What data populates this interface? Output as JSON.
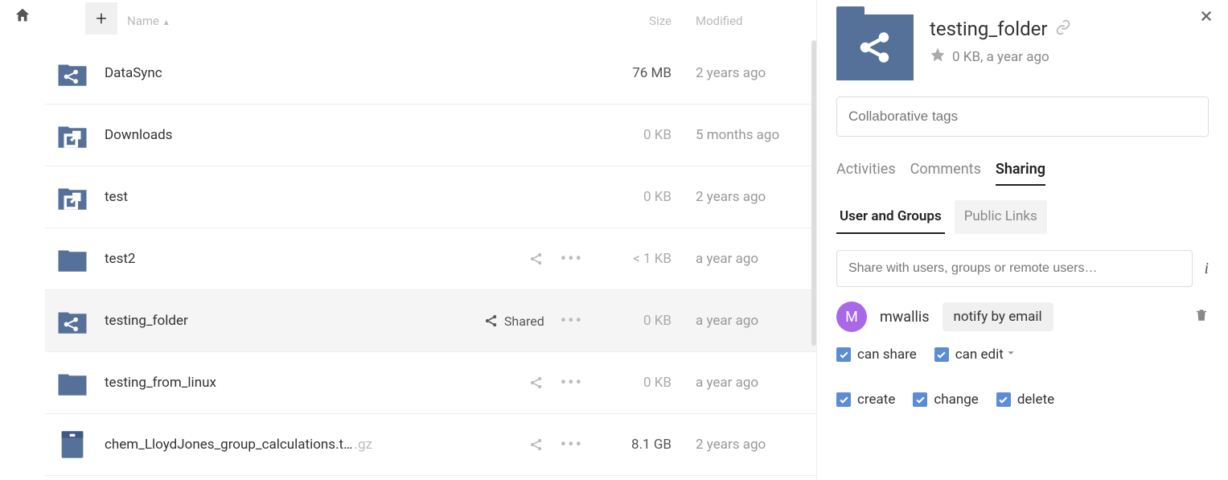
{
  "header": {
    "name": "Name",
    "sort_indicator": "▲",
    "size": "Size",
    "modified": "Modified"
  },
  "plus_label": "+",
  "files": [
    {
      "name": "DataSync",
      "icon": "folder-share",
      "size": "76 MB",
      "size_faded": false,
      "modified": "2 years ago",
      "selected": false,
      "show_actions": false,
      "shared_label": ""
    },
    {
      "name": "Downloads",
      "icon": "folder-external",
      "size": "0 KB",
      "size_faded": true,
      "modified": "5 months ago",
      "selected": false,
      "show_actions": false,
      "shared_label": ""
    },
    {
      "name": "test",
      "icon": "folder-external",
      "size": "0 KB",
      "size_faded": true,
      "modified": "2 years ago",
      "selected": false,
      "show_actions": false,
      "shared_label": ""
    },
    {
      "name": "test2",
      "icon": "folder",
      "size": "< 1 KB",
      "size_faded": true,
      "modified": "a year ago",
      "selected": false,
      "show_actions": true,
      "shared_label": ""
    },
    {
      "name": "testing_folder",
      "icon": "folder-share",
      "size": "0 KB",
      "size_faded": true,
      "modified": "a year ago",
      "selected": true,
      "show_actions": true,
      "shared_label": "Shared"
    },
    {
      "name": "testing_from_linux",
      "icon": "folder",
      "size": "0 KB",
      "size_faded": true,
      "modified": "a year ago",
      "selected": false,
      "show_actions": true,
      "shared_label": ""
    },
    {
      "name": "chem_LloydJones_group_calculations.t…",
      "ext": ".gz",
      "icon": "archive",
      "size": "8.1 GB",
      "size_faded": false,
      "modified": "2 years ago",
      "selected": false,
      "show_actions": true,
      "shared_label": ""
    }
  ],
  "sidebar": {
    "title": "testing_folder",
    "meta": "0 KB, a year ago",
    "tags_placeholder": "Collaborative tags",
    "tabs": {
      "activities": "Activities",
      "comments": "Comments",
      "sharing": "Sharing"
    },
    "subtabs": {
      "users": "User and Groups",
      "public": "Public Links"
    },
    "share_placeholder": "Share with users, groups or remote users…",
    "user": {
      "initial": "M",
      "name": "mwallis",
      "notify": "notify by email"
    },
    "perms": {
      "can_share": "can share",
      "can_edit": "can edit",
      "create": "create",
      "change": "change",
      "delete": "delete"
    }
  }
}
